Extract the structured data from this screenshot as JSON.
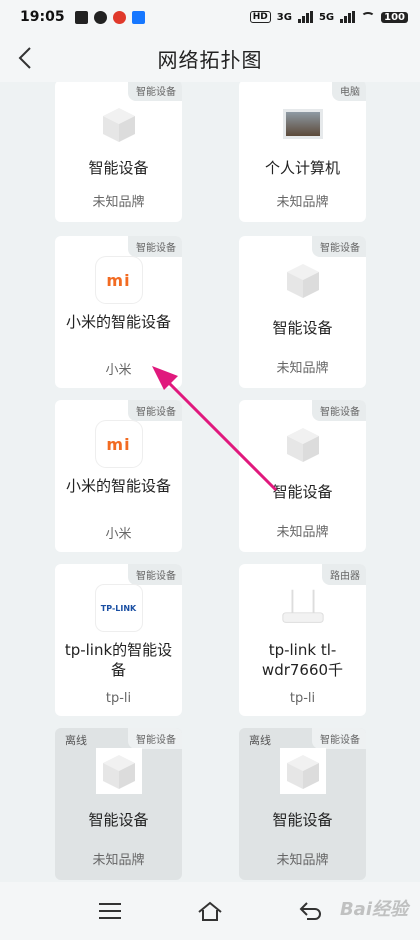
{
  "status_bar": {
    "time": "19:05",
    "hd": "HD",
    "net1": "3G",
    "net2": "5G",
    "battery": "100"
  },
  "header": {
    "title": "网络拓扑图"
  },
  "devices": [
    {
      "tag": "智能设备",
      "name": "智能设备",
      "brand": "未知品牌",
      "icon": "cube-icon",
      "offline": false
    },
    {
      "tag": "电脑",
      "name": "个人计算机",
      "brand": "未知品牌",
      "icon": "computer-icon",
      "offline": false
    },
    {
      "tag": "智能设备",
      "name": "小米的智能设备",
      "brand": "小米",
      "icon": "mi-logo-icon",
      "offline": false
    },
    {
      "tag": "智能设备",
      "name": "智能设备",
      "brand": "未知品牌",
      "icon": "cube-icon",
      "offline": false
    },
    {
      "tag": "智能设备",
      "name": "小米的智能设备",
      "brand": "小米",
      "icon": "mi-logo-icon",
      "offline": false
    },
    {
      "tag": "智能设备",
      "name": "智能设备",
      "brand": "未知品牌",
      "icon": "cube-icon",
      "offline": false
    },
    {
      "tag": "智能设备",
      "name": "tp-link的智能设备",
      "brand": "tp-li",
      "icon": "tplink-logo-icon",
      "offline": false
    },
    {
      "tag": "路由器",
      "name": "tp-link tl-wdr7660千",
      "brand": "tp-li",
      "icon": "router-icon",
      "offline": false
    },
    {
      "tag": "智能设备",
      "offline_label": "离线",
      "name": "智能设备",
      "brand": "未知品牌",
      "icon": "cube-icon",
      "offline": true
    },
    {
      "tag": "智能设备",
      "offline_label": "离线",
      "name": "智能设备",
      "brand": "未知品牌",
      "icon": "cube-icon",
      "offline": true
    }
  ],
  "logos": {
    "mi": "mi",
    "tplink": "TP-LINK"
  },
  "watermark": "Bai经验",
  "colors": {
    "accent_arrow": "#e0197d",
    "mi_orange": "#f26b22",
    "tplink_blue": "#1a4fa3"
  }
}
